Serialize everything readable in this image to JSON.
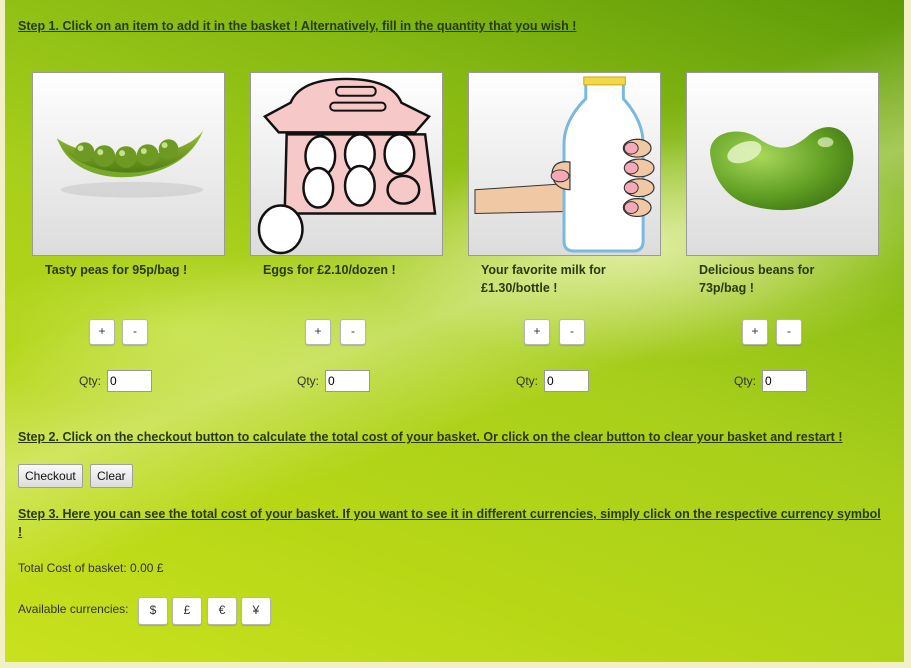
{
  "step1": "Step 1. Click on an item to add it in the basket ! Alternatively, fill in the quantity that you wish !",
  "step2": "Step 2. Click on the checkout button to calculate the total cost of your basket. Or click on the clear button to clear your basket and restart !",
  "step3": "Step 3. Here you can see the total cost of your basket. If you want to see it in different currencies, simply click on the respective currency symbol !",
  "products": [
    {
      "name": "peas",
      "description": "Tasty peas for 95p/bag !",
      "plus": "+",
      "minus": "-",
      "qty_label": "Qty:",
      "qty": "0"
    },
    {
      "name": "eggs",
      "description": "Eggs for £2.10/dozen !",
      "plus": "+",
      "minus": "-",
      "qty_label": "Qty:",
      "qty": "0"
    },
    {
      "name": "milk",
      "description": "Your favorite milk for £1.30/bottle !",
      "plus": "+",
      "minus": "-",
      "qty_label": "Qty:",
      "qty": "0"
    },
    {
      "name": "beans",
      "description": "Delicious beans for 73p/bag !",
      "plus": "+",
      "minus": "-",
      "qty_label": "Qty:",
      "qty": "0"
    }
  ],
  "buttons": {
    "checkout": "Checkout",
    "clear": "Clear"
  },
  "total_text": "Total Cost of basket: 0.00 £",
  "currencies_label": "Available currencies:",
  "currencies": [
    "$",
    "£",
    "€",
    "¥"
  ],
  "colors": {
    "background": "#9cc614",
    "page": "#f3f0c6"
  }
}
